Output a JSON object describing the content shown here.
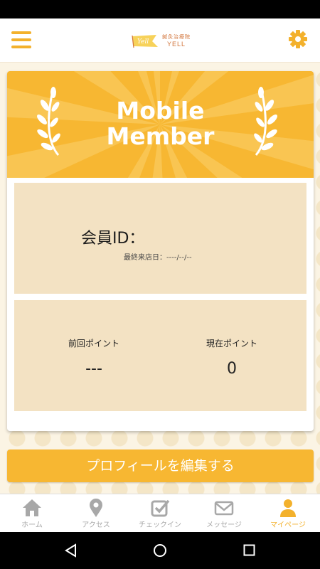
{
  "header": {
    "logo_sub": "鍼灸治療院",
    "logo_main": "YELL",
    "logo_flag": "Yell"
  },
  "banner": {
    "title_line1": "Mobile",
    "title_line2": "Member"
  },
  "member": {
    "id_label": "会員ID：",
    "last_visit_label": "最終来店日：",
    "last_visit_value": "----/--/--"
  },
  "points": {
    "previous_label": "前回ポイント",
    "previous_value": "---",
    "current_label": "現在ポイント",
    "current_value": "0"
  },
  "edit_button": "プロフィールを編集する",
  "tabs": [
    {
      "label": "ホーム",
      "icon": "home-icon",
      "active": false
    },
    {
      "label": "アクセス",
      "icon": "map-pin-icon",
      "active": false
    },
    {
      "label": "チェックイン",
      "icon": "checkin-icon",
      "active": false
    },
    {
      "label": "メッセージ",
      "icon": "mail-icon",
      "active": false
    },
    {
      "label": "マイページ",
      "icon": "user-icon",
      "active": true
    }
  ],
  "colors": {
    "accent": "#f7b732",
    "panel": "#f3e2c3",
    "background": "#fbf4e4",
    "inactive_tab": "#a8a8a8"
  }
}
